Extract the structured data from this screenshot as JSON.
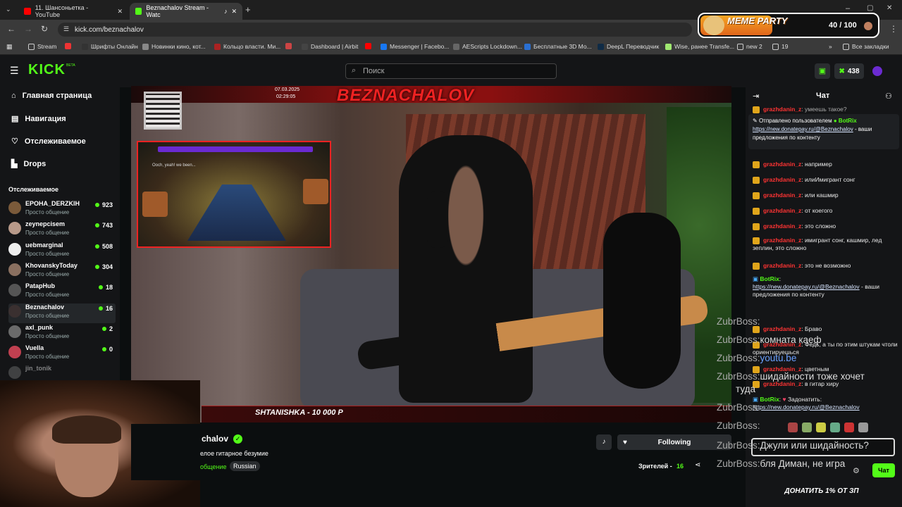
{
  "browser": {
    "tabs": [
      {
        "label": "11. Шансоньетка - YouTube"
      },
      {
        "label": "Beznachalov Stream - Watc"
      }
    ],
    "url": "kick.com/beznachalov",
    "bookmarks": [
      "Stream",
      "Шрифты Онлайн",
      "Новинки кино, кот...",
      "Кольцо власти. Ми...",
      "Dashboard | Airbit",
      "Messenger | Facebo...",
      "AEScripts Lockdown...",
      "Бесплатные 3D Мо...",
      "DeepL Переводчик",
      "Wise, ранее Transfe...",
      "new 2",
      "19",
      "Все закладки"
    ]
  },
  "meme_party": {
    "title": "MEME PARTY",
    "progress_text": "40 / 100",
    "progress": 0.4
  },
  "kick": {
    "logo": "KICK",
    "logo_sup": "BETA",
    "search_placeholder": "Поиск",
    "kicks_count": "438"
  },
  "sidebar": {
    "nav": [
      "Главная страница",
      "Навигация",
      "Отслеживаемое",
      "Drops"
    ],
    "section_title": "Отслеживаемое",
    "channels": [
      {
        "name": "EPOHA_DERZKIH",
        "sub": "Просто общение",
        "count": "923",
        "color": "#7a5a3a"
      },
      {
        "name": "zeynepcisem",
        "sub": "Просто общение",
        "count": "743",
        "color": "#b89a8a"
      },
      {
        "name": "uebmarginal",
        "sub": "Просто общение",
        "count": "508",
        "color": "#eeeeee"
      },
      {
        "name": "KhovanskyToday",
        "sub": "Просто общение",
        "count": "304",
        "color": "#8a7060"
      },
      {
        "name": "PatapHub",
        "sub": "Просто общение",
        "count": "18",
        "color": "#555555"
      },
      {
        "name": "Beznachalov",
        "sub": "Просто общение",
        "count": "16",
        "color": "#3a3030"
      },
      {
        "name": "axl_punk",
        "sub": "Просто общение",
        "count": "2",
        "color": "#6a6a6a"
      },
      {
        "name": "Vuella",
        "sub": "Просто общение",
        "count": "0",
        "color": "#c04050"
      },
      {
        "name": "jin_tonik",
        "sub": "",
        "count": "",
        "color": "#777777"
      }
    ]
  },
  "video": {
    "banner": "BEZNACHALOV",
    "date": "07.03.2025",
    "time": "02:29:05",
    "donation": "SHTANISHKA - 10 000 Р",
    "guitar_text": "Ooch, yeah! we been..."
  },
  "stream_info": {
    "name": "chalov",
    "desc": "елое гитарное безумие",
    "category": "общение",
    "tag": "Russian",
    "follow_label": "Following",
    "viewers_label": "Зрителей -",
    "viewers": "16"
  },
  "chat": {
    "title": "Чат",
    "pinned": {
      "by": "Отправлено пользователем",
      "user": "BotRix",
      "link": "https://new.donatepay.ru/@Beznachalov",
      "text": "- ваши предложения по контенту"
    },
    "top_partial": "умеешь такое?",
    "messages": [
      {
        "user": "grazhdanin_z",
        "text": "например"
      },
      {
        "user": "grazhdanin_z",
        "text": "илиИмигрант сонг"
      },
      {
        "user": "grazhdanin_z",
        "text": "или кашмир"
      },
      {
        "user": "grazhdanin_z",
        "text": "от коегого"
      },
      {
        "user": "grazhdanin_z",
        "text": "это сложно"
      },
      {
        "user": "grazhdanin_z",
        "text": "имигрант сонг, кашмир, лед зеплин, это сложно"
      },
      {
        "user": "grazhdanin_z",
        "text": "это не возможно"
      }
    ],
    "botrix1": {
      "user": "BotRix",
      "link": "https://new.donatepay.ru/@Beznachalov",
      "text": "- ваши предложения по контенту"
    },
    "messages2": [
      {
        "user": "grazhdanin_z",
        "text": "Браво"
      },
      {
        "user": "grazhdanin_z",
        "text": "Федь, а ты по этим штукам чтоли ориентируешься"
      },
      {
        "user": "grazhdanin_z",
        "text": "цветным"
      },
      {
        "user": "grazhdanin_z",
        "text": "в гитар хиру"
      }
    ],
    "botrix2": {
      "user": "BotRix",
      "label": "Задонатить:",
      "link": "https://new.donatepay.ru/@Beznachalov"
    },
    "send_label": "Чат",
    "bottom_banner": "ДОНАТИТЬ 1% ОТ ЗП"
  },
  "overlay_chat": [
    {
      "user": "ZubrBoss:",
      "text": ""
    },
    {
      "user": "ZubrBoss:",
      "text": "комната каеф"
    },
    {
      "user": "ZubrBoss:",
      "text": "youtu.be"
    },
    {
      "user": "ZubrBoss:",
      "text": "шидайности тоже хочет"
    },
    {
      "user": "",
      "text": "туда"
    },
    {
      "user": "ZubrBoss:",
      "text": ""
    },
    {
      "user": "ZubrBoss:",
      "text": ""
    },
    {
      "user": "ZubrBoss:",
      "text": "Джули или шидайность?"
    },
    {
      "user": "ZubrBoss:",
      "text": "бля Диман, не игра"
    }
  ]
}
